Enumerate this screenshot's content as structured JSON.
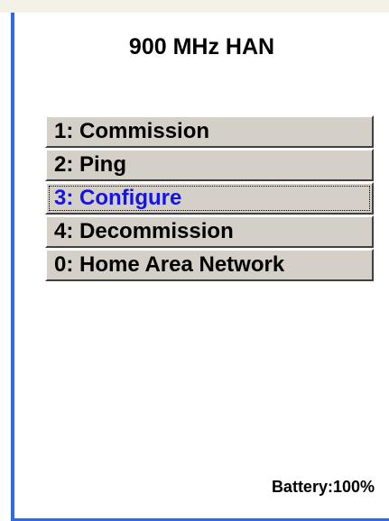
{
  "screen": {
    "title": "900 MHz HAN",
    "menu": [
      {
        "label": "1: Commission"
      },
      {
        "label": "2: Ping"
      },
      {
        "label": "3: Configure",
        "focused": true
      },
      {
        "label": "4: Decommission"
      },
      {
        "label": "0: Home Area Network"
      }
    ],
    "status": {
      "battery": "Battery:100%"
    }
  },
  "colors": {
    "menu_face": "#d4d0c8",
    "focused_text": "#1414e6",
    "border_accent": "#2f6ae6"
  }
}
